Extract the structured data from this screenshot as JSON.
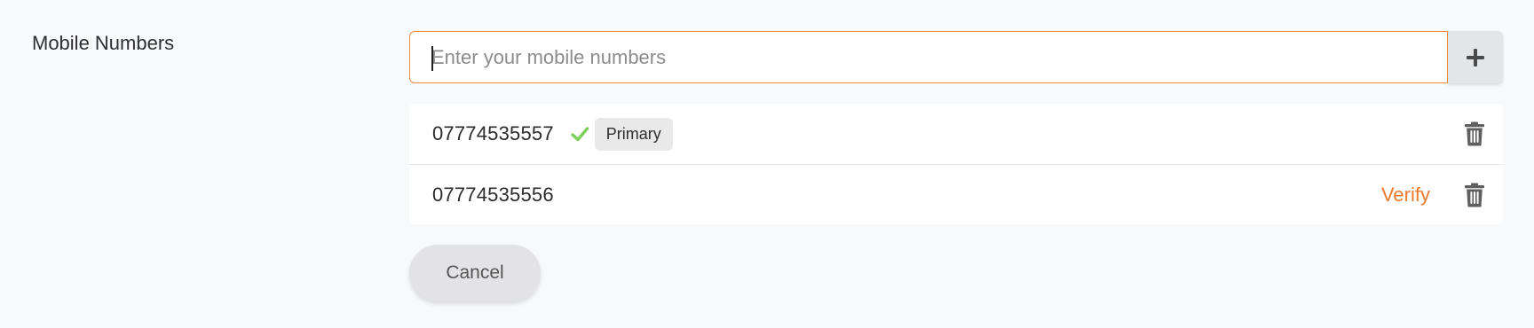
{
  "section": {
    "label": "Mobile Numbers"
  },
  "add_form": {
    "input_value": "",
    "placeholder": "Enter your mobile numbers",
    "add_button_icon": "plus-icon"
  },
  "numbers": [
    {
      "number": "07774535557",
      "verified": true,
      "badge": "Primary",
      "verify_label": "",
      "delete_icon": "trash-icon"
    },
    {
      "number": "07774535556",
      "verified": false,
      "badge": "",
      "verify_label": "Verify",
      "delete_icon": "trash-icon"
    }
  ],
  "actions": {
    "cancel_label": "Cancel"
  },
  "colors": {
    "accent": "#ee7a2c",
    "input_border": "#f08a3e",
    "verified_check": "#7ccf5a",
    "background": "#f8f9fb"
  }
}
